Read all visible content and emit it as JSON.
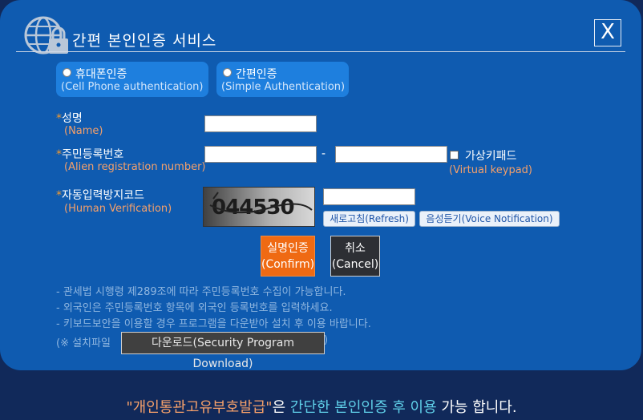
{
  "dialog": {
    "title": "간편 본인인증 서비스",
    "close_label": "X"
  },
  "auth_options": [
    {
      "label": "휴대폰인증",
      "sublabel": "(Cell Phone authentication)"
    },
    {
      "label": "간편인증",
      "sublabel": "(Simple Authentication)"
    }
  ],
  "form": {
    "required_mark": "*",
    "name_label": "성명",
    "name_sub": "(Name)",
    "reg_label": "주민등록번호",
    "reg_sub": "(Alien registration number)",
    "reg_separator": "-",
    "virtual_keypad_label": "가상키패드",
    "virtual_keypad_sub": "(Virtual keypad)",
    "captcha_label": "자동입력방지코드",
    "captcha_sub": "(Human Verification)",
    "captcha_text": "044530",
    "refresh_label": "새로고침(Refresh)",
    "voice_label": "음성듣기(Voice Notification)"
  },
  "actions": {
    "confirm_line1": "실명인증",
    "confirm_line2": "(Confirm)",
    "cancel_line1": "취소",
    "cancel_line2": "(Cancel)"
  },
  "notes": [
    "- 관세법 시행령 제289조에 따라 주민등록번호 수집이 가능합니다.",
    "- 외국인은 주민등록번호 항목에 외국인 등록번호를 입력하세요.",
    "- 키보드보안을 이용할 경우 프로그램을 다운받아 설치 후 이용 바랍니다."
  ],
  "download": {
    "prefix": "(※ 설치파일",
    "button": "다운로드(Security Program Download)",
    "suffix": ")"
  },
  "footer": {
    "quoted": "\"개인통관고유부호발급\"",
    "part2": "은 ",
    "highlight": "간단한 본인인증 후 이용",
    "part3": " 가능 합니다."
  },
  "colors": {
    "background": "#11295a",
    "dialog": "#0f5bb0",
    "accent_orange": "#ef6a13",
    "sub_label": "#f5a06a"
  }
}
